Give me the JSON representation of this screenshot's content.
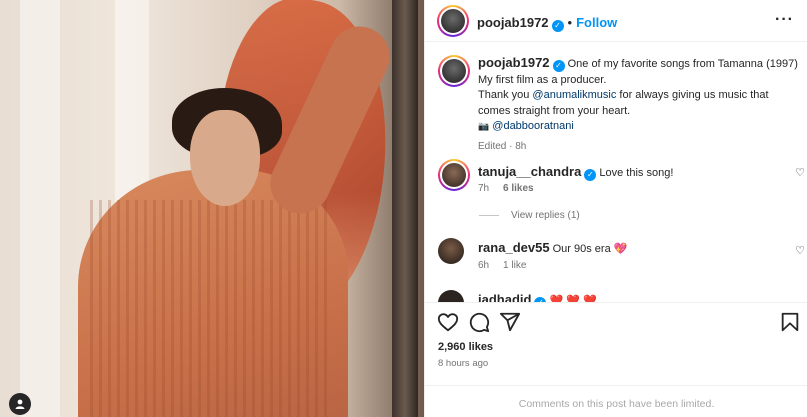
{
  "post": {
    "author": "poojab1972",
    "follow_label": "Follow",
    "more_icon": "more-icon",
    "separator": "•"
  },
  "caption": {
    "username": "poojab1972",
    "line1": "One of my favorite songs from Tamanna (1997)",
    "line2": "My first film as a producer.",
    "line3_prefix": "Thank you ",
    "mention1": "@anumalikmusic",
    "line3_suffix": " for always giving us music that",
    "line4": "comes straight from your heart.",
    "camera_icon": "📷",
    "mention2": "@dabbooratnani",
    "meta": "Edited · 8h"
  },
  "comments": [
    {
      "username": "tanuja__chandra",
      "verified": true,
      "text": "Love this song!",
      "time": "7h",
      "likes": "6 likes",
      "view_replies": "View replies (1)"
    },
    {
      "username": "rana_dev55",
      "verified": false,
      "text": "Our 90s era ",
      "emoji": "💖",
      "time": "6h",
      "likes": "1 like"
    },
    {
      "username": "jadhadid",
      "verified": true,
      "emoji": "❤️ ❤️ ❤️"
    }
  ],
  "footer": {
    "likes": "2,960 likes",
    "time": "8 hours ago",
    "comments_limited": "Comments on this post have been limited."
  },
  "colors": {
    "accent": "#0095f6",
    "text": "#262626",
    "muted": "#737373",
    "heart_red": "#ed4956"
  }
}
